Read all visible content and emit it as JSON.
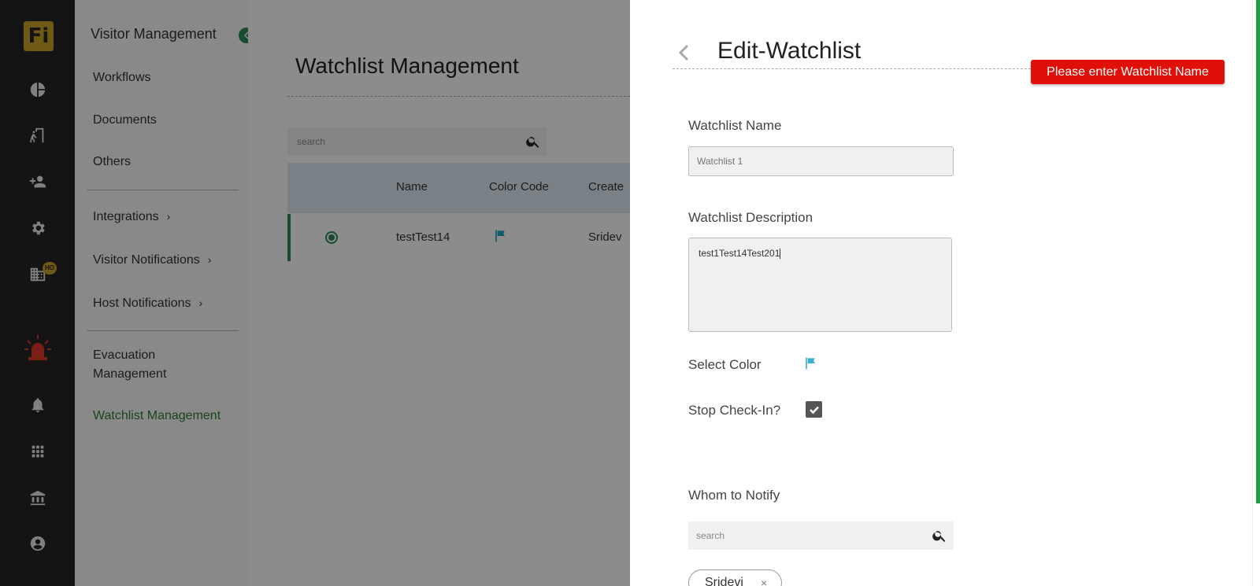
{
  "rail": {
    "logo_text": "Fi",
    "badge": "HO",
    "icons": [
      "chart-pie-icon",
      "door-walk-icon",
      "person-add-icon",
      "gear-icon",
      "building-icon",
      "alarm-siren-icon",
      "bell-icon",
      "grid-icon",
      "bank-icon",
      "account-circle-icon"
    ]
  },
  "sidebar": {
    "title": "Visitor Management",
    "items": {
      "workflows": "Workflows",
      "documents": "Documents",
      "others": "Others",
      "integrations": "Integrations",
      "visitor_notifications": "Visitor Notifications",
      "host_notifications": "Host Notifications",
      "evacuation_1": "Evacuation",
      "evacuation_2": "Management",
      "watchlist": "Watchlist Management"
    },
    "active_color": "#2e7d32"
  },
  "main": {
    "page_title": "Watchlist Management",
    "search_placeholder": "search",
    "table": {
      "columns": [
        "Name",
        "Color Code",
        "Create"
      ],
      "rows": [
        {
          "name": "testTest14",
          "color_icon": "flag-icon",
          "created_by": "Sridev"
        }
      ]
    }
  },
  "drawer": {
    "title": "Edit-Watchlist",
    "error": "Please enter Watchlist Name",
    "name_label": "Watchlist Name",
    "name_placeholder": "Watchlist 1",
    "name_value": "",
    "description_label": "Watchlist Description",
    "description_value": "test1Test14Test201",
    "color_label": "Select Color",
    "color_value": "#3bb0d6",
    "stop_checkin_label": "Stop Check-In?",
    "stop_checkin_checked": true,
    "notify_label": "Whom to Notify",
    "notify_search_placeholder": "search",
    "chips": [
      "Sridevi"
    ],
    "chip_remove": "×"
  },
  "colors": {
    "rail_bg": "#262626",
    "accent_green": "#2e8b57",
    "error_red": "#e01008",
    "table_header": "#dce9f4"
  }
}
